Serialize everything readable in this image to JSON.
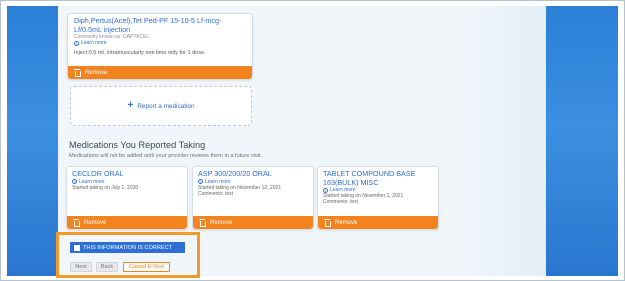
{
  "colors": {
    "accent": "#2d6fd6",
    "remove": "#f2831f",
    "highlight": "#f39a2b"
  },
  "current_med": {
    "name": "Diph,Pertus(Acel),Tet Ped-PF 15-10-5 Lf-mcg-Lf/0.5mL injection",
    "known_as": "Commonly known as: DAPTACEL",
    "learn": "Learn more",
    "instructions": "Inject 0.5 mL intramuscularly one time only for 1 dose.",
    "remove": "Remove",
    "remove_icon": "trash-icon"
  },
  "report": {
    "label": "Report a medication",
    "icon": "plus-icon"
  },
  "section": {
    "title": "Medications You Reported Taking",
    "subtitle": "Medications will not be added until your provider reviews them in a future visit."
  },
  "reported": [
    {
      "name": "CECLOR ORAL",
      "learn": "Learn more",
      "started": "Started taking on July 1, 2020",
      "comments": "",
      "remove": "Remove"
    },
    {
      "name": "ASP 300/200/20 ORAL",
      "learn": "Learn more",
      "started": "Started taking on November 12, 2021",
      "comments": "Comments: test",
      "remove": "Remove"
    },
    {
      "name": "TABLET COMPOUND BASE 163(BULK) MISC",
      "learn": "Learn more",
      "started": "Started taking on November 1, 2021",
      "comments": "Comments: test",
      "remove": "Remove"
    }
  ],
  "confirm": {
    "checkbox_label": "THIS INFORMATION IS CORRECT",
    "next": "Next",
    "back": "Back",
    "cancel": "Cancel E-Visit"
  }
}
